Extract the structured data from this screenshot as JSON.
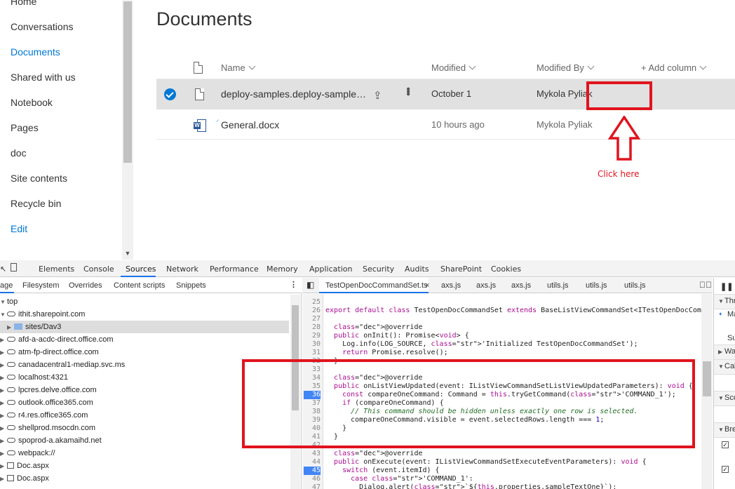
{
  "sharepoint": {
    "nav_items": [
      "Home",
      "Conversations",
      "Documents",
      "Shared with us",
      "Notebook",
      "Pages",
      "doc",
      "Site contents",
      "Recycle bin",
      "Edit"
    ],
    "page_title": "Documents",
    "columns": {
      "name": "Name",
      "modified": "Modified",
      "modified_by": "Modified By",
      "add_column": "+ Add column"
    },
    "files": [
      {
        "name": "deploy-samples.deploy-sample…",
        "modified": "October 1",
        "modified_by": "Mykola Pyliak",
        "selected": true
      },
      {
        "name": "General.docx",
        "modified": "10 hours ago",
        "modified_by": "Mykola Pyliak",
        "selected": false
      }
    ],
    "annotation": {
      "label": "Click here",
      "color": "#e0141e"
    },
    "accent": "#0078d4"
  },
  "devtools": {
    "tabs": [
      "Elements",
      "Console",
      "Sources",
      "Network",
      "Performance",
      "Memory",
      "Application",
      "Security",
      "Audits",
      "SharePoint",
      "Cookies"
    ],
    "active_tab": "Sources",
    "navigator_tabs": [
      "age",
      "Filesystem",
      "Overrides",
      "Content scripts",
      "Snippets"
    ],
    "tree": [
      {
        "label": "top",
        "kind": "frame"
      },
      {
        "label": "ithit.sharepoint.com",
        "kind": "cloud"
      },
      {
        "label": "sites/Dav3",
        "kind": "folder"
      },
      {
        "label": "afd-a-acdc-direct.office.com",
        "kind": "cloud"
      },
      {
        "label": "atm-fp-direct.office.com",
        "kind": "cloud"
      },
      {
        "label": "canadacentral1-mediap.svc.ms",
        "kind": "cloud"
      },
      {
        "label": "localhost:4321",
        "kind": "cloud"
      },
      {
        "label": "lpcres.delve.office.com",
        "kind": "cloud"
      },
      {
        "label": "outlook.office365.com",
        "kind": "cloud"
      },
      {
        "label": "r4.res.office365.com",
        "kind": "cloud"
      },
      {
        "label": "shellprod.msocdn.com",
        "kind": "cloud"
      },
      {
        "label": "spoprod-a.akamaihd.net",
        "kind": "cloud"
      },
      {
        "label": "webpack://",
        "kind": "cloud"
      },
      {
        "label": "Doc.aspx",
        "kind": "frame"
      },
      {
        "label": "Doc.aspx",
        "kind": "frame"
      }
    ],
    "editor_tabs": [
      "TestOpenDocCommandSet.ts",
      "axs.js",
      "axs.js",
      "axs.js",
      "utils.js",
      "utils.js",
      "utils.js"
    ],
    "active_editor_tab": "TestOpenDocCommandSet.ts",
    "breakpoint_color": "#4285f4",
    "code_lines": [
      {
        "n": "25",
        "text": ""
      },
      {
        "n": "26",
        "text": "export default class TestOpenDocCommandSet extends BaseListViewCommandSet<ITestOpenDocComma"
      },
      {
        "n": "27",
        "text": ""
      },
      {
        "n": "28",
        "text": "  @override"
      },
      {
        "n": "29",
        "text": "  public onInit(): Promise<void> {"
      },
      {
        "n": "30",
        "text": "    Log.info(LOG_SOURCE, 'Initialized TestOpenDocCommandSet');"
      },
      {
        "n": "31",
        "text": "    return Promise.resolve();"
      },
      {
        "n": "32",
        "text": "  }"
      },
      {
        "n": "33",
        "text": ""
      },
      {
        "n": "34",
        "text": "  @override"
      },
      {
        "n": "35",
        "text": "  public onListViewUpdated(event: IListViewCommandSetListViewUpdatedParameters): void {"
      },
      {
        "n": "36",
        "text": "    const compareOneCommand: Command = this.tryGetCommand('COMMAND_1');"
      },
      {
        "n": "37",
        "text": "    if (compareOneCommand) {"
      },
      {
        "n": "38",
        "text": "      // This command should be hidden unless exactly one row is selected."
      },
      {
        "n": "39",
        "text": "      compareOneCommand.visible = event.selectedRows.length === 1;"
      },
      {
        "n": "40",
        "text": "    }"
      },
      {
        "n": "41",
        "text": "  }"
      },
      {
        "n": "42",
        "text": ""
      },
      {
        "n": "43",
        "text": "  @override"
      },
      {
        "n": "44",
        "text": "  public onExecute(event: IListViewCommandSetExecuteEventParameters): void {"
      },
      {
        "n": "45",
        "text": "    switch (event.itemId) {"
      },
      {
        "n": "46",
        "text": "      case 'COMMAND_1':"
      },
      {
        "n": "47",
        "text": "        Dialog.alert(`${this.properties.sampleTextOne}`);"
      }
    ],
    "breakpoint_lines": [
      "36",
      "45"
    ],
    "side_pane": [
      "Thr",
      "Ma",
      "Sui",
      "Wa",
      "Cal",
      "Sco",
      "Bre"
    ]
  }
}
